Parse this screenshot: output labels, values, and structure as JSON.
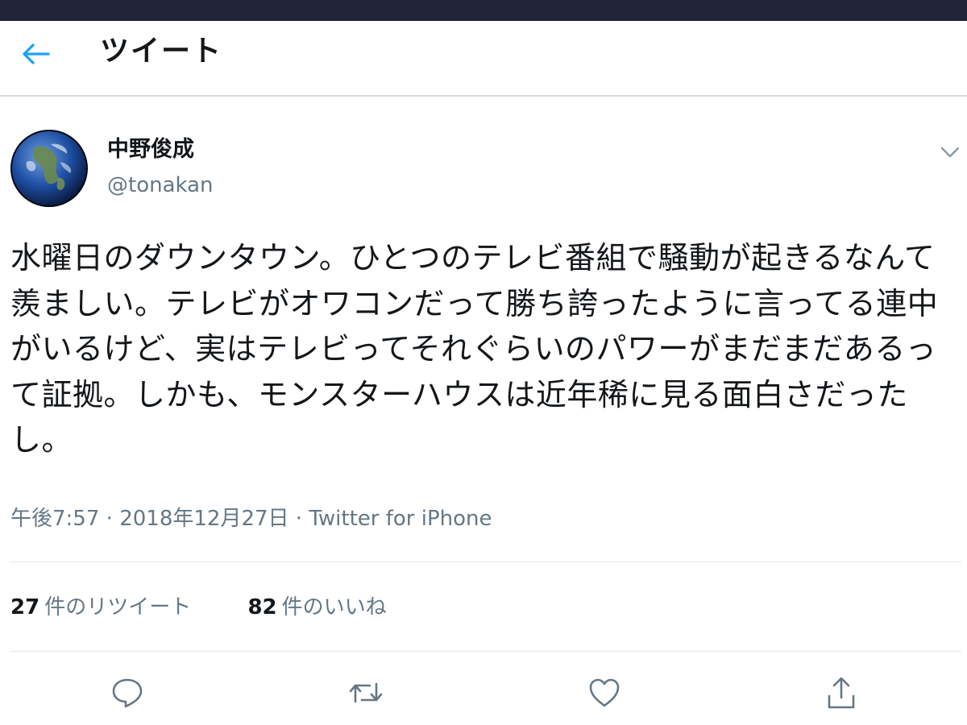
{
  "header": {
    "title": "ツイート",
    "back_icon": "arrow-left-icon",
    "accent_color": "#1da1f2"
  },
  "tweet": {
    "author": {
      "name": "中野俊成",
      "handle": "@tonakan",
      "avatar": "earth-globe-avatar"
    },
    "more_icon": "chevron-down-icon",
    "text": "水曜日のダウンタウン。ひとつのテレビ番組で騒動が起きるなんて羨ましい。テレビがオワコンだって勝ち誇ったように言ってる連中がいるけど、実はテレビってそれぐらいのパワーがまだまだあるって証拠。しかも、モンスターハウスは近年稀に見る面白さだったし。",
    "time": "午後7:57",
    "separator": "·",
    "date": "2018年12月27日",
    "source": "Twitter for iPhone"
  },
  "stats": {
    "retweets": {
      "count": "27",
      "label": "件のリツイート"
    },
    "likes": {
      "count": "82",
      "label": "件のいいね"
    }
  },
  "actions": {
    "reply_icon": "reply-bubble-icon",
    "retweet_icon": "retweet-icon",
    "like_icon": "heart-icon",
    "share_icon": "share-icon"
  },
  "colors": {
    "text": "#14171a",
    "secondary": "#657786",
    "divider": "#e1e8ed",
    "status_bar": "#22243a"
  }
}
